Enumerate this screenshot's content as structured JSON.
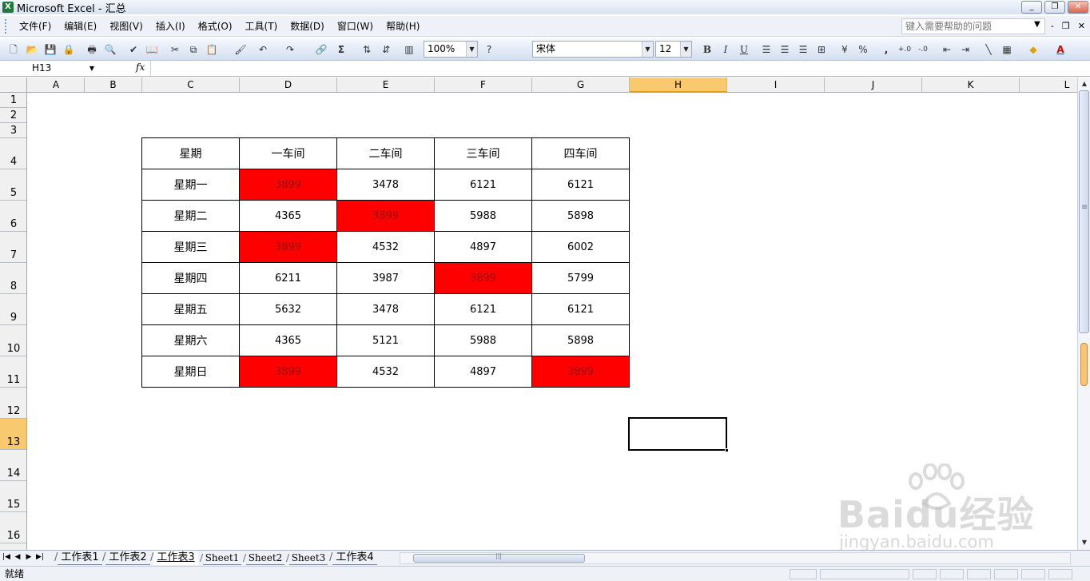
{
  "window": {
    "title": "Microsoft Excel - 汇总",
    "app_icon": "X",
    "minimize": "_",
    "restore": "❐",
    "close": "✕"
  },
  "menu": {
    "items": [
      "文件(F)",
      "编辑(E)",
      "视图(V)",
      "插入(I)",
      "格式(O)",
      "工具(T)",
      "数据(D)",
      "窗口(W)",
      "帮助(H)"
    ],
    "help_placeholder": "键入需要帮助的问题",
    "doc_min": "-",
    "doc_restore": "❐",
    "doc_close": "✕"
  },
  "toolbar": {
    "zoom": "100%",
    "font_name": "宋体",
    "font_size": "12",
    "bold": "B",
    "italic": "I",
    "underline": "U",
    "percent": "%",
    "comma": ",",
    "sum": "Σ"
  },
  "formula_bar": {
    "name_box": "H13",
    "fx": "fx",
    "value": ""
  },
  "columns": [
    "A",
    "B",
    "C",
    "D",
    "E",
    "F",
    "G",
    "H",
    "I",
    "J",
    "K",
    "L"
  ],
  "rows": [
    "1",
    "2",
    "3",
    "4",
    "5",
    "6",
    "7",
    "8",
    "9",
    "10",
    "11",
    "12",
    "13",
    "14",
    "15",
    "16"
  ],
  "selected_cell": {
    "column": "H",
    "row": "13"
  },
  "table": {
    "headers": [
      "星期",
      "一车间",
      "二车间",
      "三车间",
      "四车间"
    ],
    "rows": [
      {
        "day": "星期一",
        "values": [
          "3899",
          "3478",
          "6121",
          "6121"
        ],
        "highlight": [
          true,
          false,
          false,
          false
        ]
      },
      {
        "day": "星期二",
        "values": [
          "4365",
          "3899",
          "5988",
          "5898"
        ],
        "highlight": [
          false,
          true,
          false,
          false
        ]
      },
      {
        "day": "星期三",
        "values": [
          "3899",
          "4532",
          "4897",
          "6002"
        ],
        "highlight": [
          true,
          false,
          false,
          false
        ]
      },
      {
        "day": "星期四",
        "values": [
          "6211",
          "3987",
          "3899",
          "5799"
        ],
        "highlight": [
          false,
          false,
          true,
          false
        ]
      },
      {
        "day": "星期五",
        "values": [
          "5632",
          "3478",
          "6121",
          "6121"
        ],
        "highlight": [
          false,
          false,
          false,
          false
        ]
      },
      {
        "day": "星期六",
        "values": [
          "4365",
          "5121",
          "5988",
          "5898"
        ],
        "highlight": [
          false,
          false,
          false,
          false
        ]
      },
      {
        "day": "星期日",
        "values": [
          "3899",
          "4532",
          "4897",
          "3899"
        ],
        "highlight": [
          true,
          false,
          false,
          true
        ]
      }
    ],
    "highlight_color": "#ff0000"
  },
  "sheet_tabs": {
    "tabs": [
      "工作表1",
      "工作表2",
      "工作表3",
      "Sheet1",
      "Sheet2",
      "Sheet3",
      "工作表4"
    ],
    "active": "工作表3"
  },
  "status": {
    "text": "就绪"
  },
  "watermark": {
    "text": "Baidu经验",
    "sub": "jingyan.baidu.com"
  }
}
